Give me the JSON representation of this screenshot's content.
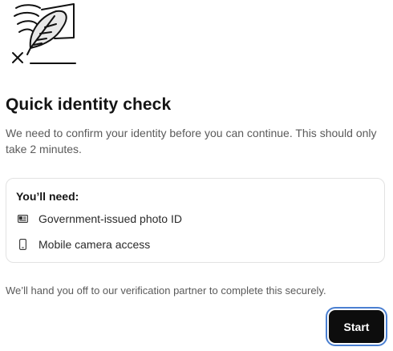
{
  "illustration": {
    "icon": "feather-signature-icon"
  },
  "header": {
    "title": "Quick identity check",
    "description": "We need to confirm your identity before you can continue. This should only take 2 minutes."
  },
  "needs": {
    "heading": "You’ll need:",
    "items": [
      {
        "icon": "id-card-icon",
        "label": "Government-issued photo ID"
      },
      {
        "icon": "mobile-phone-icon",
        "label": "Mobile camera access"
      }
    ]
  },
  "footer": {
    "handoff_text": "We’ll hand you off to our verification partner to complete this securely.",
    "start_label": "Start"
  },
  "colors": {
    "button_bg": "#0d0d0d",
    "focus_ring": "#4a7fd1",
    "card_border": "#e2e2e2"
  }
}
